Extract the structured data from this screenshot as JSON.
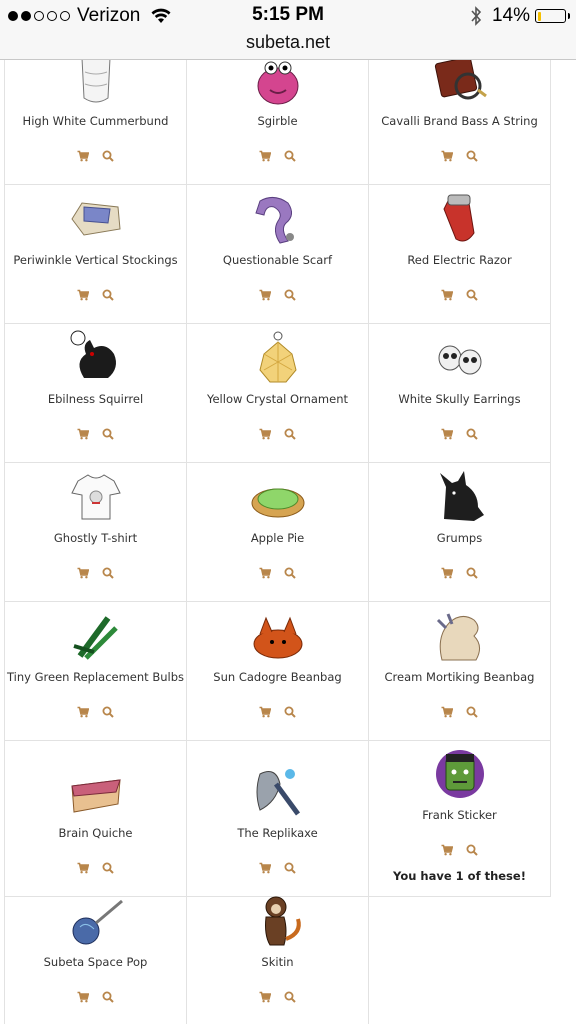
{
  "status_bar": {
    "carrier": "Verizon",
    "time": "5:15 PM",
    "battery": "14%",
    "battery_level": 0.14,
    "battery_color": "#f5c000"
  },
  "url": "subeta.net",
  "accent_color": "#b8864b",
  "items": [
    {
      "name": "High White Cummerbund",
      "icon": "cummerbund-icon"
    },
    {
      "name": "Sgirble",
      "icon": "pink-creature-icon"
    },
    {
      "name": "Cavalli Brand Bass A String",
      "icon": "bass-string-icon"
    },
    {
      "name": "Periwinkle Vertical Stockings",
      "icon": "stockings-box-icon"
    },
    {
      "name": "Questionable Scarf",
      "icon": "purple-scarf-icon"
    },
    {
      "name": "Red Electric Razor",
      "icon": "electric-razor-icon"
    },
    {
      "name": "Ebilness Squirrel",
      "icon": "black-squirrel-icon"
    },
    {
      "name": "Yellow Crystal Ornament",
      "icon": "crystal-ornament-icon"
    },
    {
      "name": "White Skully Earrings",
      "icon": "skull-earrings-icon"
    },
    {
      "name": "Ghostly T-shirt",
      "icon": "tshirt-icon"
    },
    {
      "name": "Apple Pie",
      "icon": "apple-pie-icon"
    },
    {
      "name": "Grumps",
      "icon": "black-creature-icon"
    },
    {
      "name": "Tiny Green Replacement Bulbs",
      "icon": "green-bulbs-icon"
    },
    {
      "name": "Sun Cadogre Beanbag",
      "icon": "orange-beanbag-icon"
    },
    {
      "name": "Cream Mortiking Beanbag",
      "icon": "cream-beanbag-icon"
    },
    {
      "name": "Brain Quiche",
      "icon": "quiche-slice-icon"
    },
    {
      "name": "The Replikaxe",
      "icon": "axe-icon"
    },
    {
      "name": "Frank Sticker",
      "icon": "frank-sticker-icon",
      "owned_note": "You have 1 of these!"
    },
    {
      "name": "Subeta Space Pop",
      "icon": "lollipop-icon"
    },
    {
      "name": "Skitin",
      "icon": "monkey-icon"
    }
  ]
}
